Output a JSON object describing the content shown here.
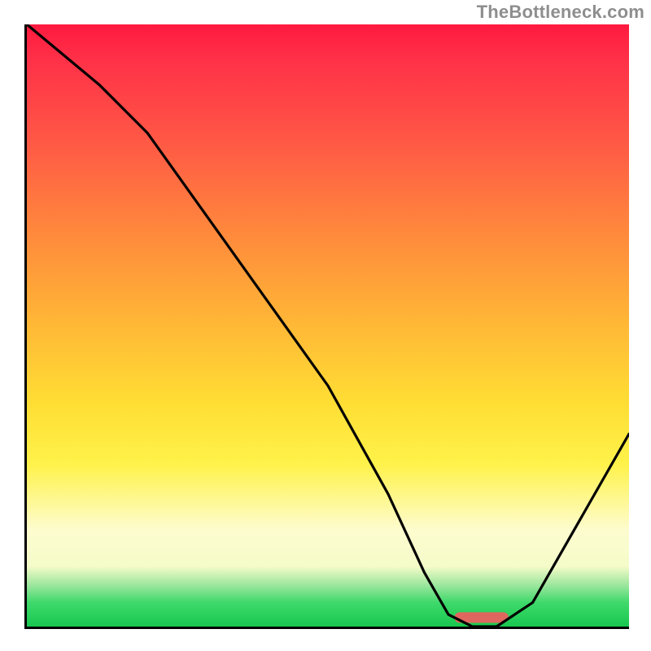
{
  "watermark": "TheBottleneck.com",
  "chart_data": {
    "type": "line",
    "title": "",
    "xlabel": "",
    "ylabel": "",
    "xlim": [
      0,
      100
    ],
    "ylim": [
      0,
      100
    ],
    "grid": false,
    "legend": false,
    "series": [
      {
        "name": "bottleneck-curve",
        "x": [
          0,
          12,
          20,
          30,
          40,
          50,
          60,
          66,
          70,
          74,
          78,
          84,
          92,
          100
        ],
        "y": [
          100,
          90,
          82,
          68,
          54,
          40,
          22,
          9,
          2,
          0,
          0,
          4,
          18,
          32
        ]
      }
    ],
    "marker": {
      "name": "optimal-range",
      "shape": "rounded-bar",
      "x_start": 71,
      "x_end": 80,
      "y": 1.5,
      "color": "#e0675f"
    },
    "background_gradient": {
      "direction": "vertical",
      "stops": [
        {
          "pos": 0.0,
          "color": "#ff1a3f"
        },
        {
          "pos": 0.35,
          "color": "#ff8a3c"
        },
        {
          "pos": 0.63,
          "color": "#ffde34"
        },
        {
          "pos": 0.88,
          "color": "#fdfccf"
        },
        {
          "pos": 1.0,
          "color": "#17c84f"
        }
      ]
    }
  }
}
